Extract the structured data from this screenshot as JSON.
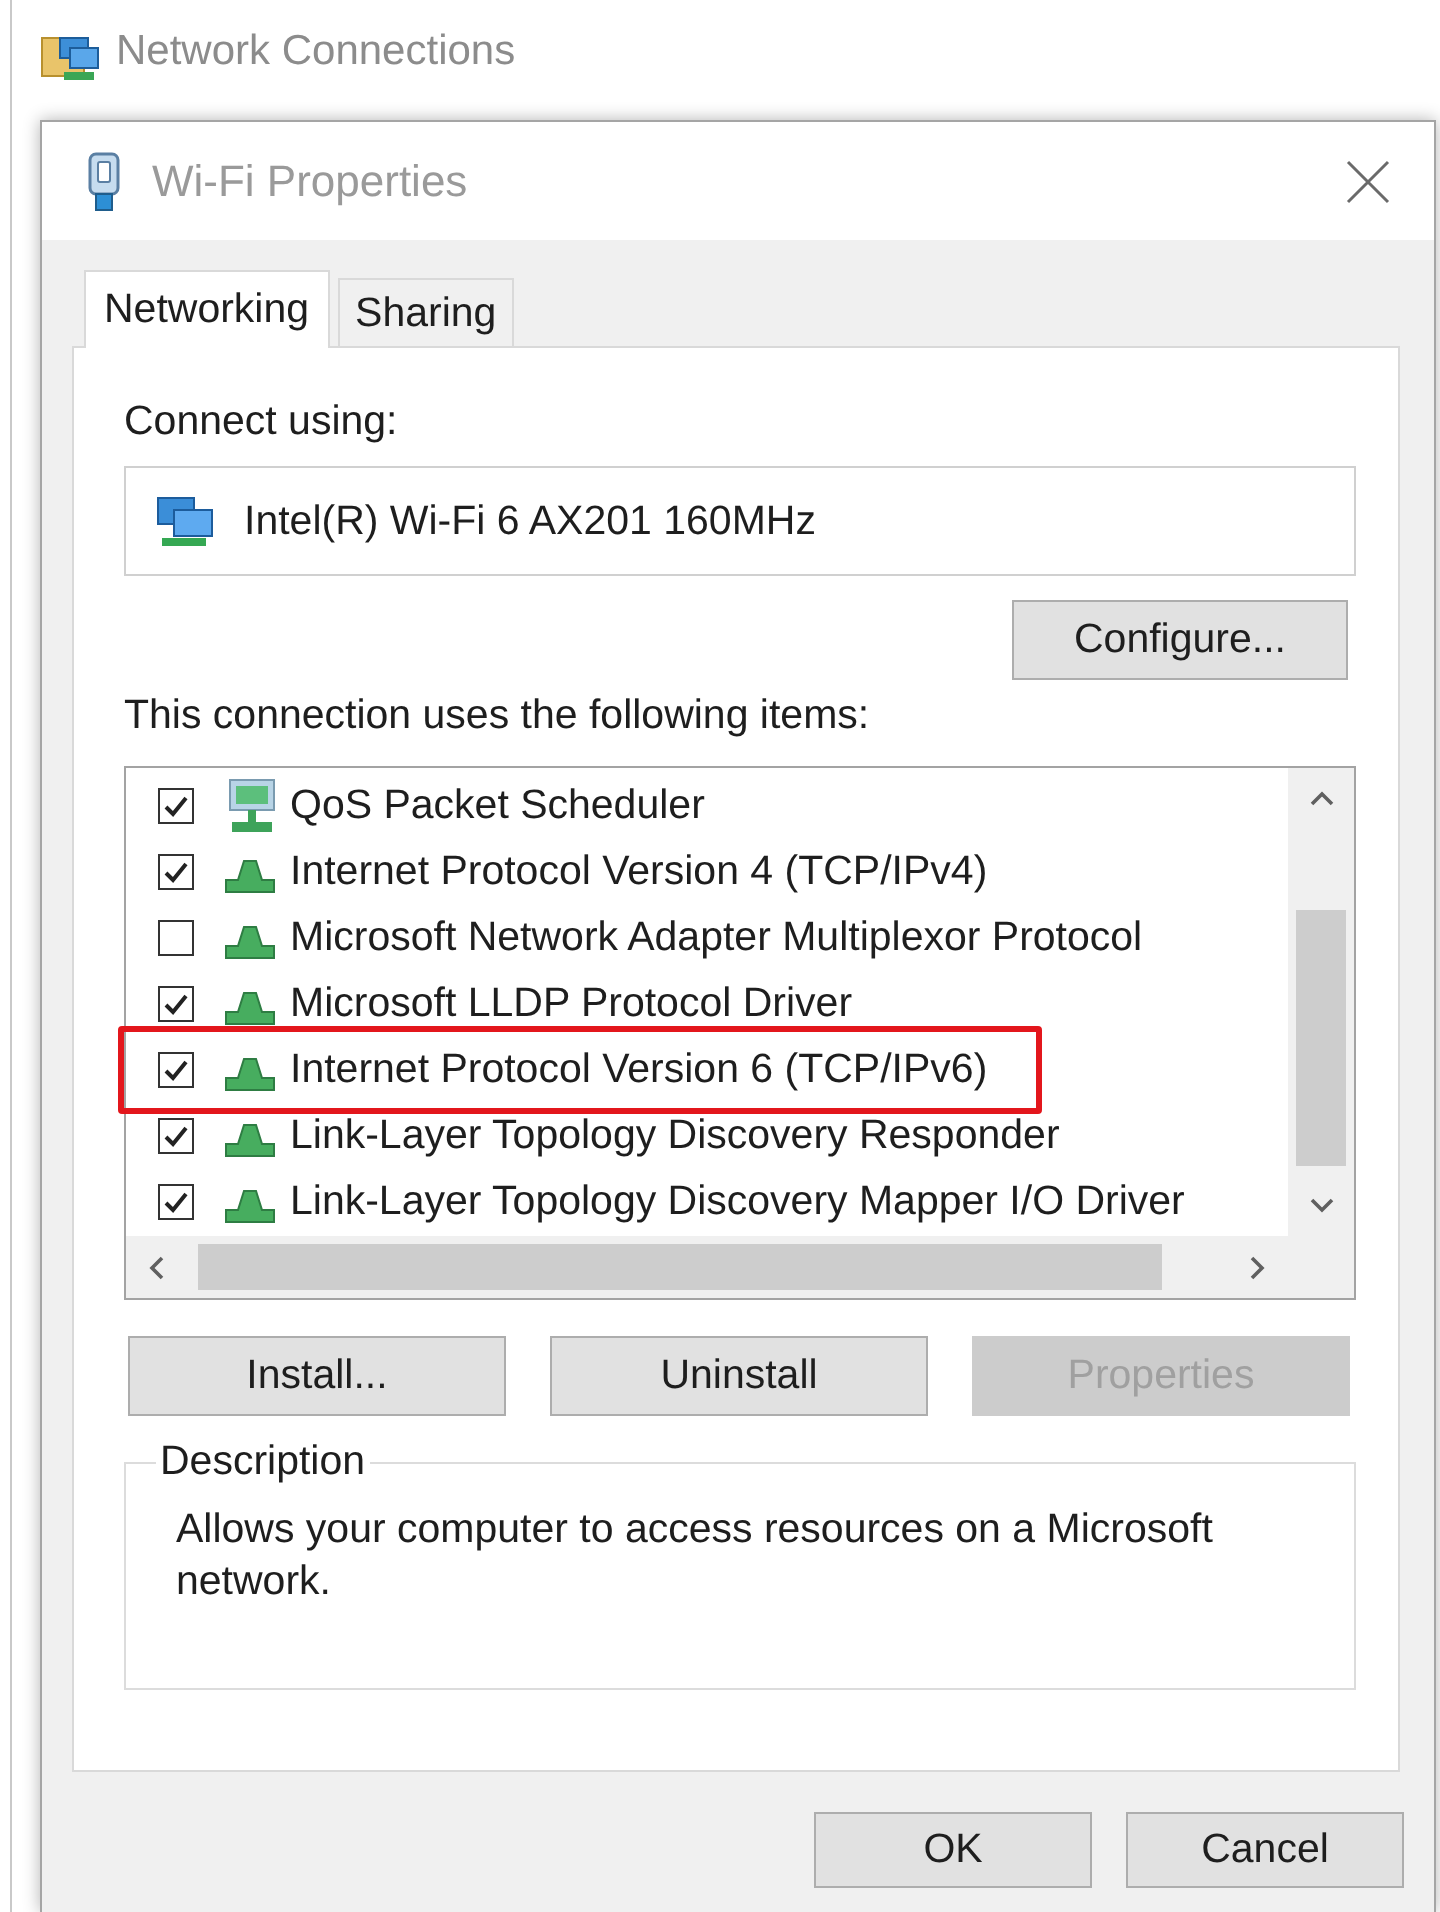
{
  "background_window": {
    "title": "Network Connections"
  },
  "dialog": {
    "title": "Wi-Fi Properties"
  },
  "tabs": [
    {
      "label": "Networking",
      "selected": true
    },
    {
      "label": "Sharing",
      "selected": false
    }
  ],
  "connect_using": {
    "label": "Connect using:",
    "adapter": "Intel(R) Wi-Fi 6 AX201 160MHz",
    "configure_button": "Configure..."
  },
  "items_label": "This connection uses the following items:",
  "items": [
    {
      "name": "QoS Packet Scheduler",
      "kind": "service",
      "checked": true,
      "highlighted": false
    },
    {
      "name": "Internet Protocol Version 4 (TCP/IPv4)",
      "kind": "protocol",
      "checked": true,
      "highlighted": false
    },
    {
      "name": "Microsoft Network Adapter Multiplexor Protocol",
      "kind": "protocol",
      "checked": false,
      "highlighted": false
    },
    {
      "name": "Microsoft LLDP Protocol Driver",
      "kind": "protocol",
      "checked": true,
      "highlighted": false
    },
    {
      "name": "Internet Protocol Version 6 (TCP/IPv6)",
      "kind": "protocol",
      "checked": true,
      "highlighted": true
    },
    {
      "name": "Link-Layer Topology Discovery Responder",
      "kind": "protocol",
      "checked": true,
      "highlighted": false
    },
    {
      "name": "Link-Layer Topology Discovery Mapper I/O Driver",
      "kind": "protocol",
      "checked": true,
      "highlighted": false
    }
  ],
  "item_buttons": [
    {
      "label": "Install...",
      "disabled": false
    },
    {
      "label": "Uninstall",
      "disabled": false
    },
    {
      "label": "Properties",
      "disabled": true
    }
  ],
  "description": {
    "title": "Description",
    "text": "Allows your computer to access resources on a Microsoft network."
  },
  "footer_buttons": [
    "OK",
    "Cancel"
  ]
}
